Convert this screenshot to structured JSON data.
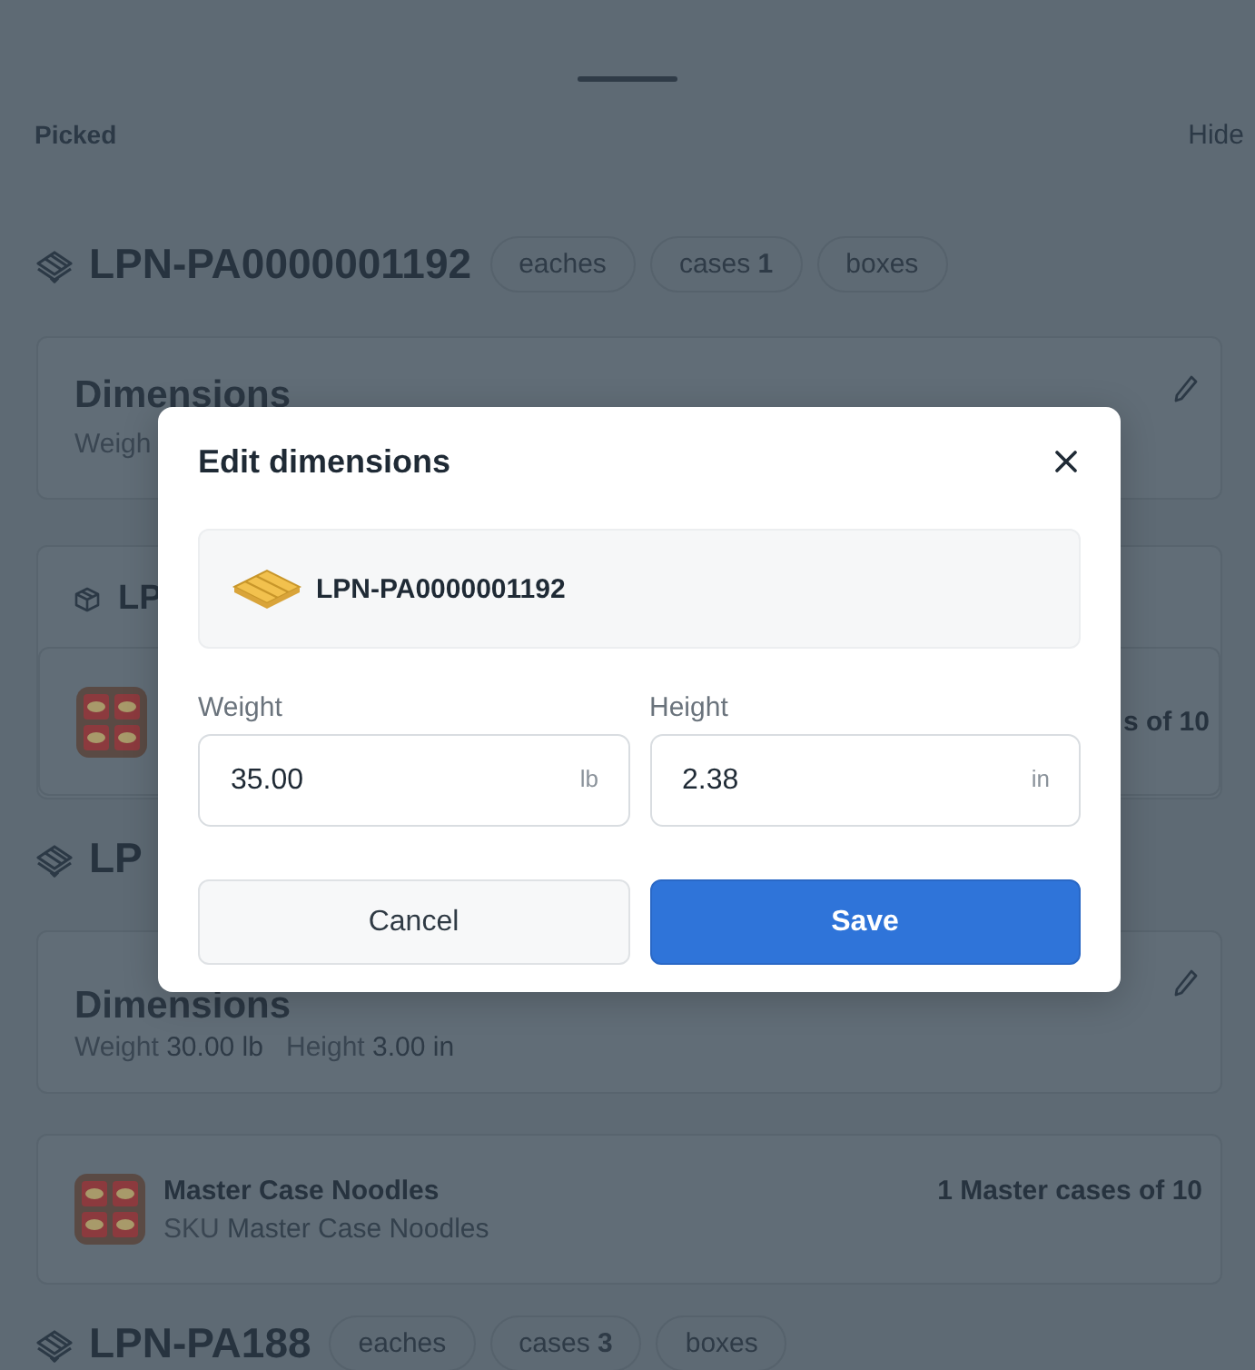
{
  "sheet": {
    "section_title": "Picked",
    "hide_link": "Hide"
  },
  "blocks": [
    {
      "kind": "lpn_header",
      "title": "LPN-PA0000001192",
      "chips": [
        "eaches",
        "cases **1**",
        "boxes"
      ]
    },
    {
      "kind": "dimensions_card",
      "title": "Dimensions",
      "weight_label": "Weigh"
    },
    {
      "kind": "case_group",
      "title": "LP",
      "quantity": "s of 10"
    },
    {
      "kind": "lpn_header",
      "title": "LP"
    },
    {
      "kind": "dimensions_card",
      "title": "Dimensions",
      "weight_label": "Weight",
      "weight_value": "30.00 lb",
      "height_label": "Height",
      "height_value": "3.00 in"
    },
    {
      "kind": "item_card",
      "name": "Master Case Noodles",
      "sku_label": "SKU",
      "sku_value": "Master Case Noodles",
      "quantity": "1 Master cases of 10"
    },
    {
      "kind": "lpn_header",
      "title": "LPN-PA188",
      "chips": [
        "eaches",
        "cases **3**",
        "boxes"
      ]
    }
  ],
  "modal": {
    "title": "Edit dimensions",
    "lpn": "LPN-PA0000001192",
    "fields": [
      {
        "label": "Weight",
        "value": "35.00",
        "unit": "lb"
      },
      {
        "label": "Height",
        "value": "2.38",
        "unit": "in"
      }
    ],
    "buttons": [
      {
        "label": "Cancel",
        "kind": "secondary"
      },
      {
        "label": "Save",
        "kind": "primary"
      }
    ]
  }
}
